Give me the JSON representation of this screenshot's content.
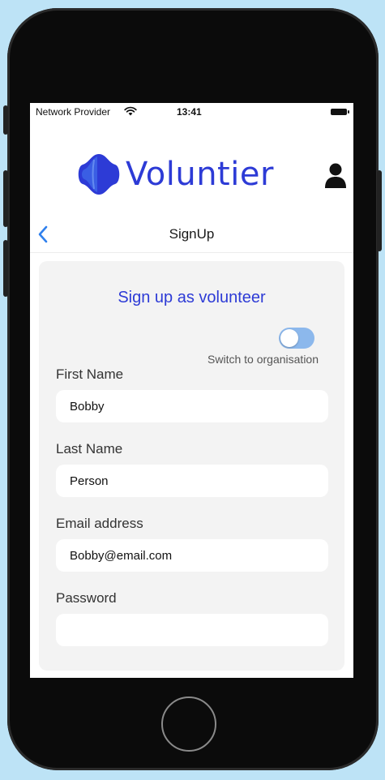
{
  "status_bar": {
    "provider": "Network Provider",
    "time": "13:41"
  },
  "header": {
    "brand": "Voluntier",
    "brand_color": "#2d3bd6",
    "profile_icon": "person-icon"
  },
  "nav": {
    "title": "SignUp",
    "back_icon": "chevron-left-icon"
  },
  "form": {
    "heading": "Sign up as volunteer",
    "toggle_label": "Switch to organisation",
    "toggle_on": false,
    "fields": [
      {
        "label": "First Name",
        "value": "Bobby"
      },
      {
        "label": "Last Name",
        "value": "Person"
      },
      {
        "label": "Email address",
        "value": "Bobby@email.com"
      },
      {
        "label": "Password",
        "value": ""
      }
    ]
  },
  "colors": {
    "background": "#bde3f6",
    "card": "#f3f3f3",
    "toggle_track": "#8cb8ec",
    "back_chevron": "#2f80ed"
  }
}
